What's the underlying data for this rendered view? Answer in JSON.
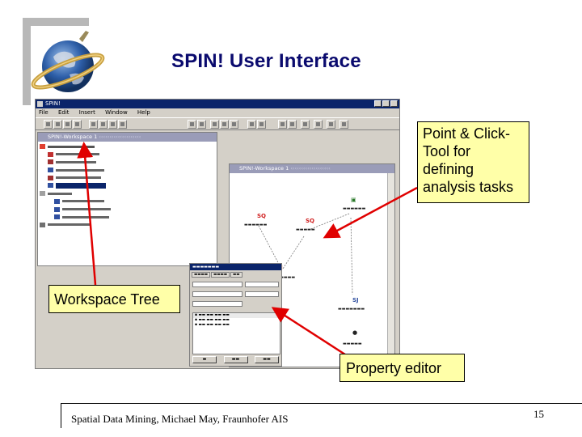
{
  "slide": {
    "title": "SPIN! User Interface",
    "footer": "Spatial Data Mining, Michael May, Fraunhofer AIS",
    "page_number": "15"
  },
  "app": {
    "window_title": "SPIN!",
    "menu": [
      "File",
      "Edit",
      "Insert",
      "Window",
      "Help"
    ],
    "tree_window_title": "SPIN!-Workspace 1",
    "workspace_window_title": "SPIN!-Workspace 1"
  },
  "callouts": {
    "point_click": "Point & Click-Tool for defining analysis tasks",
    "workspace_tree": "Workspace Tree",
    "property_editor": "Property editor"
  },
  "colors": {
    "title": "#0a0a6e",
    "callout_bg": "#ffffa8",
    "arrow": "#e00000"
  }
}
